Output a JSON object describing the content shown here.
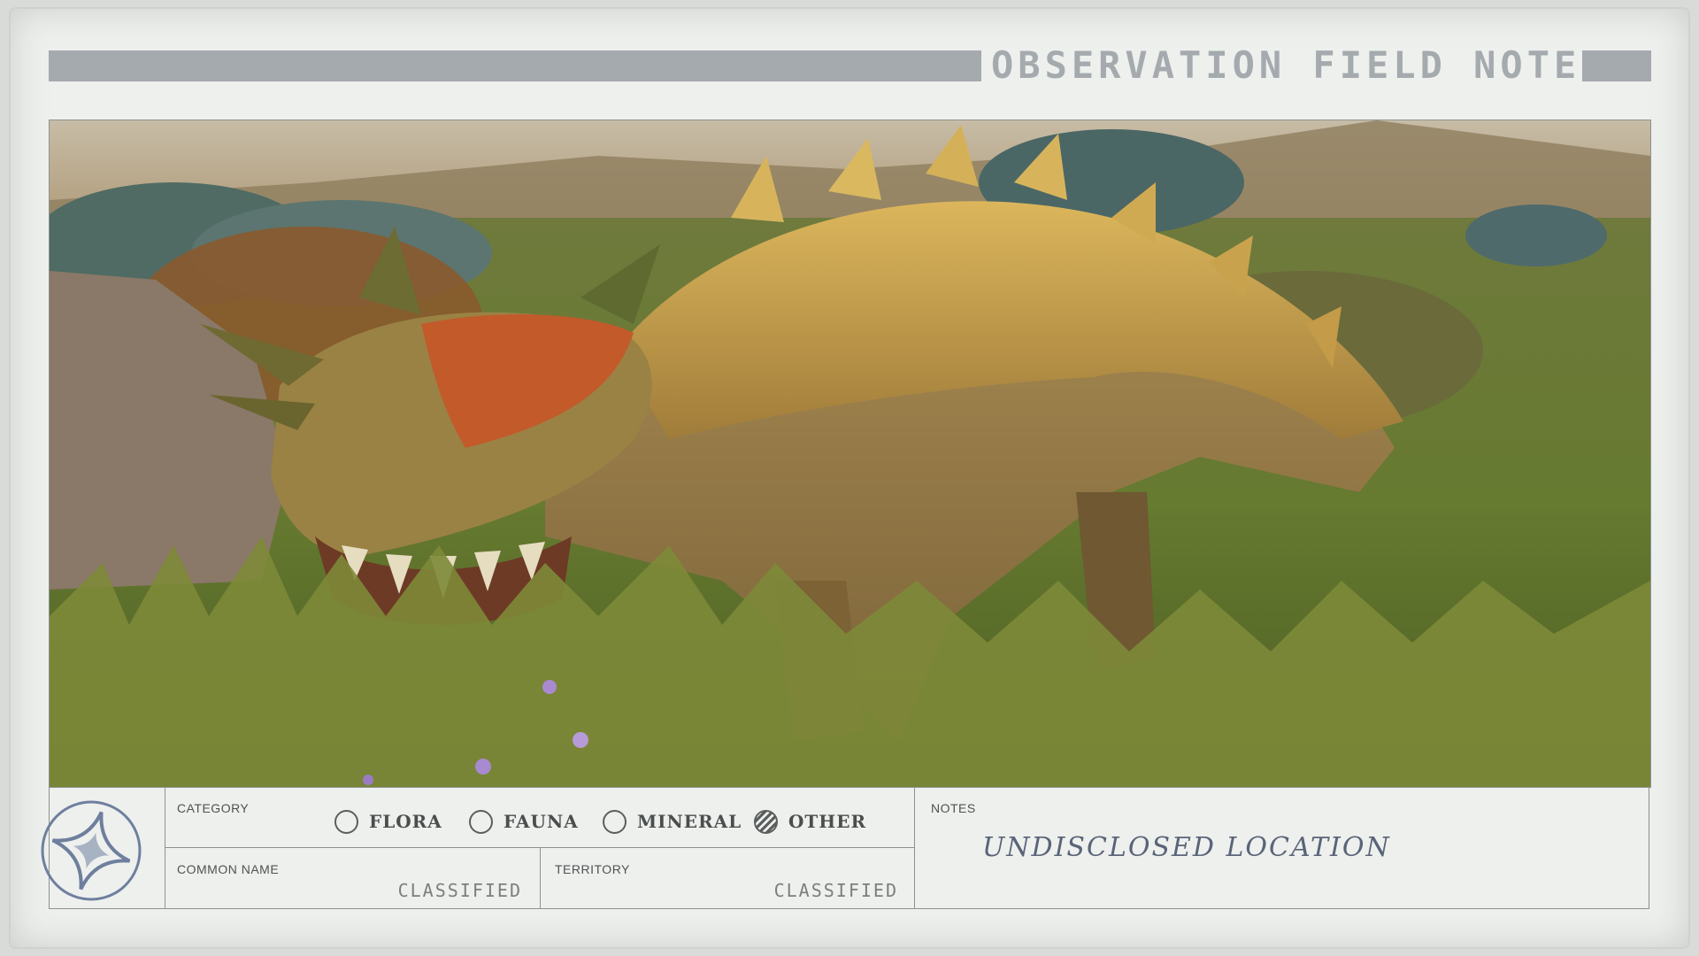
{
  "header": {
    "title": "OBSERVATION FIELD NOTES"
  },
  "form": {
    "category_label": "CATEGORY",
    "options": [
      {
        "label": "FLORA",
        "checked": false
      },
      {
        "label": "FAUNA",
        "checked": false
      },
      {
        "label": "MINERAL",
        "checked": false
      },
      {
        "label": "OTHER",
        "checked": true
      }
    ],
    "common_name_label": "COMMON NAME",
    "common_name_value": "CLASSIFIED",
    "territory_label": "TERRITORY",
    "territory_value": "CLASSIFIED",
    "notes_label": "NOTES",
    "notes_value": "UNDISCLOSED LOCATION"
  },
  "icons": {
    "emblem": "constellation-star-emblem-icon"
  },
  "colors": {
    "paper": "#eef0ee",
    "bar": "#a4aaad",
    "ink": "#5a6478"
  }
}
